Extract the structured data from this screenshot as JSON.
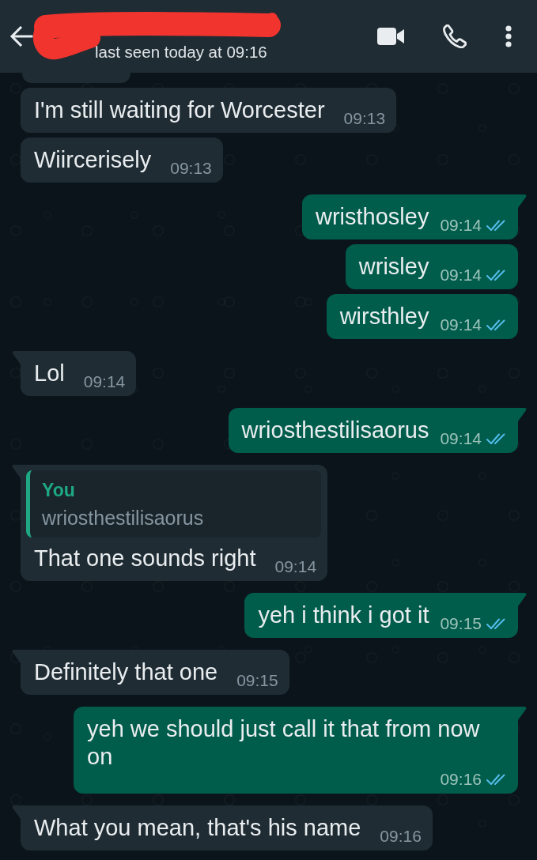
{
  "header": {
    "name_redacted": true,
    "status": "last seen today at 09:16"
  },
  "messages": [
    {
      "kind": "cut_off",
      "outgoing": false
    },
    {
      "kind": "text",
      "outgoing": false,
      "tail": false,
      "text": "I'm still waiting for Worcester",
      "time": "09:13"
    },
    {
      "kind": "text",
      "outgoing": false,
      "tail": false,
      "text": "Wiircerisely",
      "time": "09:13"
    },
    {
      "kind": "text",
      "outgoing": true,
      "tail": true,
      "text": "wristhosley",
      "time": "09:14",
      "read": true
    },
    {
      "kind": "text",
      "outgoing": true,
      "tail": false,
      "text": "wrisley",
      "time": "09:14",
      "read": true
    },
    {
      "kind": "text",
      "outgoing": true,
      "tail": false,
      "text": "wirsthley",
      "time": "09:14",
      "read": true
    },
    {
      "kind": "text",
      "outgoing": false,
      "tail": true,
      "text": "Lol",
      "time": "09:14"
    },
    {
      "kind": "text",
      "outgoing": true,
      "tail": true,
      "text": "wriosthestilisaorus",
      "time": "09:14",
      "read": true
    },
    {
      "kind": "reply",
      "outgoing": false,
      "tail": true,
      "quote": {
        "author": "You",
        "text": "wriosthestilisaorus"
      },
      "text": "That one sounds right",
      "time": "09:14"
    },
    {
      "kind": "text",
      "outgoing": true,
      "tail": true,
      "text": "yeh i think i got it",
      "time": "09:15",
      "read": true
    },
    {
      "kind": "text",
      "outgoing": false,
      "tail": true,
      "text": "Definitely that one",
      "time": "09:15"
    },
    {
      "kind": "text",
      "outgoing": true,
      "tail": true,
      "text": "yeh we should just call it that from now on",
      "time": "09:16",
      "read": true
    },
    {
      "kind": "text",
      "outgoing": false,
      "tail": true,
      "text": "What you mean, that's his name",
      "time": "09:16"
    }
  ]
}
